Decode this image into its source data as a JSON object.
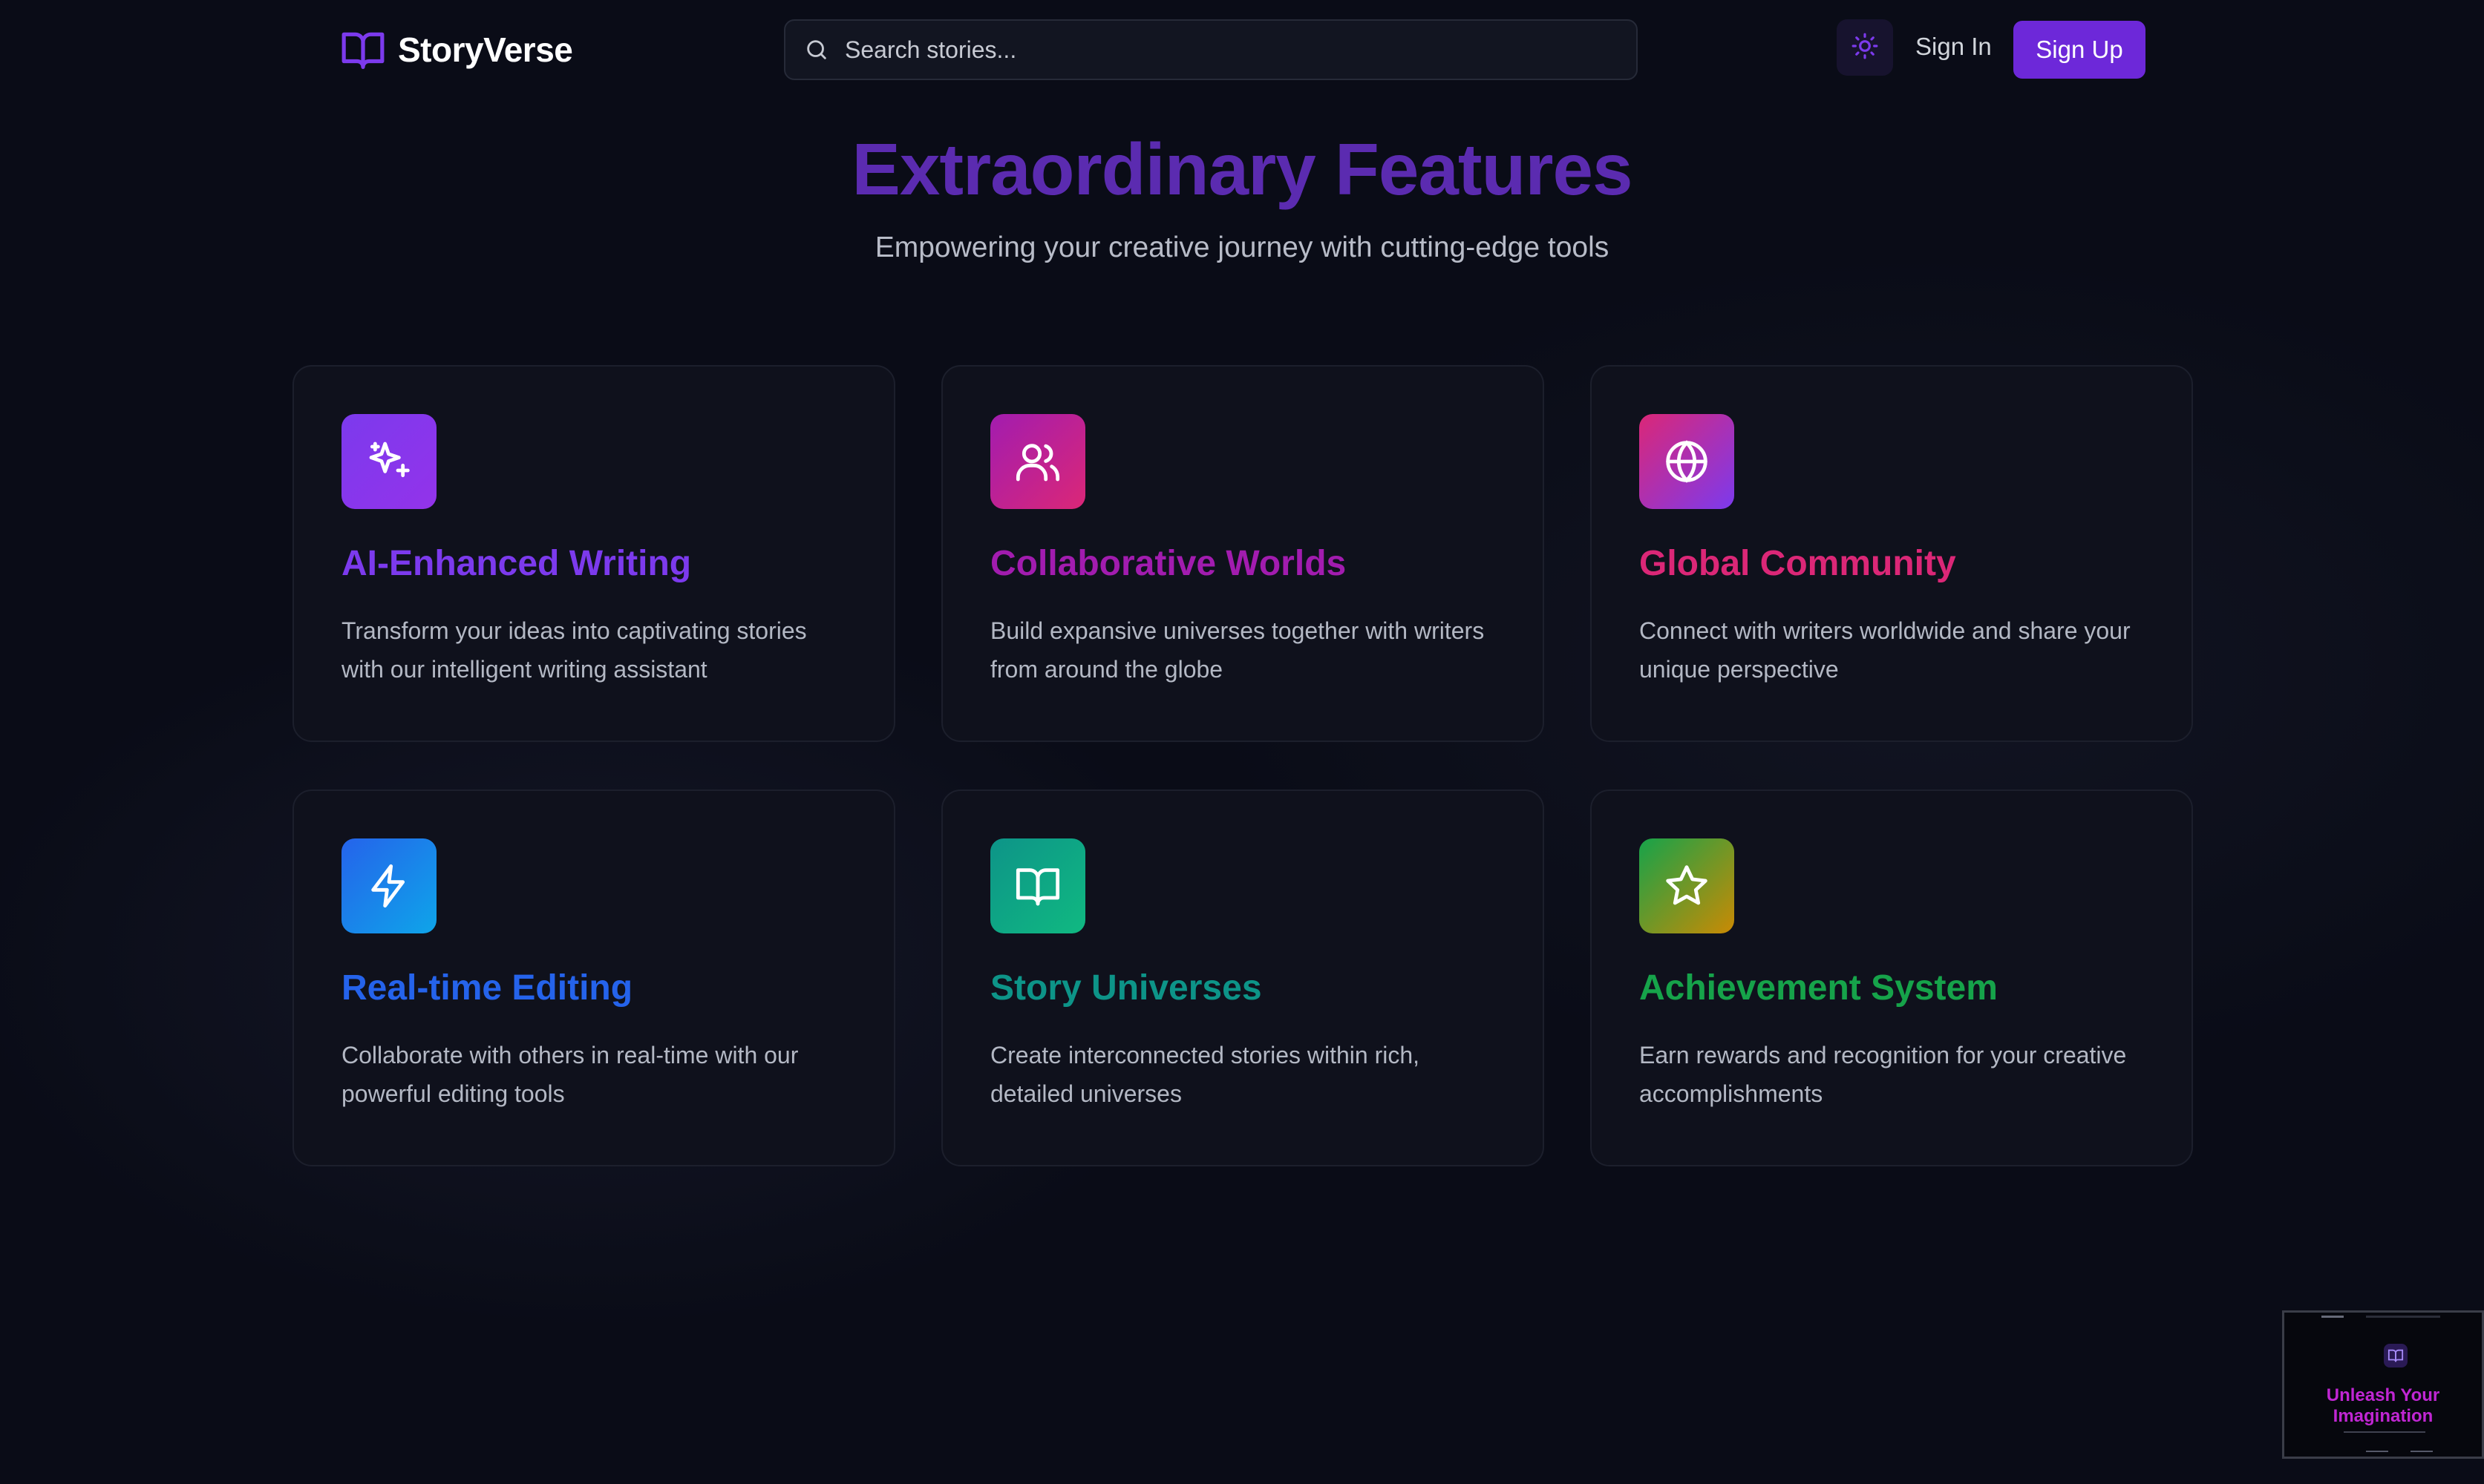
{
  "header": {
    "brand": "StoryVerse",
    "search_placeholder": "Search stories...",
    "theme_toggle_icon": "sun-icon",
    "sign_in_label": "Sign In",
    "sign_up_label": "Sign Up"
  },
  "hero": {
    "title": "Extraordinary Features",
    "subtitle": "Empowering your creative journey with cutting-edge tools"
  },
  "features": [
    {
      "title": "AI-Enhanced Writing",
      "description": "Transform your ideas into captivating stories with our intelligent writing assistant",
      "icon": "sparkles-icon",
      "color_from": "#7c3aed",
      "color_to": "#9333ea",
      "title_color": "#7c3aed"
    },
    {
      "title": "Collaborative Worlds",
      "description": "Build expansive universes together with writers from around the globe",
      "icon": "users-icon",
      "color_from": "#a21caf",
      "color_to": "#db2777",
      "title_color": "#a21caf"
    },
    {
      "title": "Global Community",
      "description": "Connect with writers worldwide and share your unique perspective",
      "icon": "globe-icon",
      "color_from": "#db2777",
      "color_to": "#7c3aed",
      "title_color": "#db2777"
    },
    {
      "title": "Real-time Editing",
      "description": "Collaborate with others in real-time with our powerful editing tools",
      "icon": "lightning-icon",
      "color_from": "#2563eb",
      "color_to": "#0ea5e9",
      "title_color": "#2563eb"
    },
    {
      "title": "Story Universes",
      "description": "Create interconnected stories within rich, detailed universes",
      "icon": "book-icon",
      "color_from": "#0d9488",
      "color_to": "#10b981",
      "title_color": "#0d9488"
    },
    {
      "title": "Achievement System",
      "description": "Earn rewards and recognition for your creative accomplishments",
      "icon": "star-icon",
      "color_from": "#16a34a",
      "color_to": "#ca8a04",
      "title_color": "#16a34a"
    }
  ],
  "minimap": {
    "title": "Unleash Your Imagination",
    "icon": "book-icon"
  },
  "colors": {
    "background": "#0a0c17",
    "accent": "#6d28d9",
    "hero_title": "#5b2bb0"
  }
}
